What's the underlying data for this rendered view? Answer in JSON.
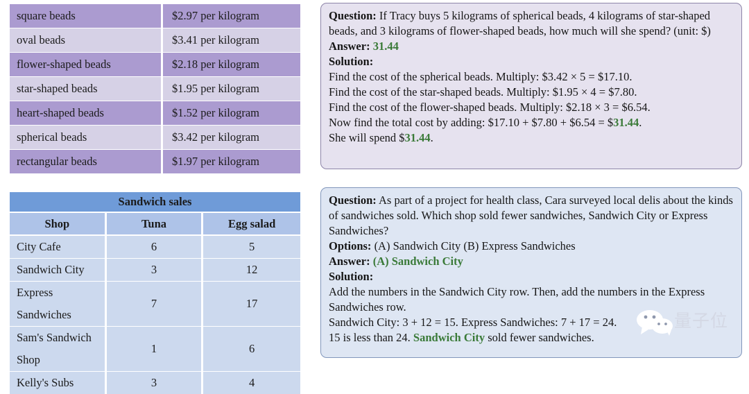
{
  "bead_table": {
    "name": "bead-price-table",
    "columns": [
      "item",
      "price"
    ],
    "rows": [
      {
        "item": "square beads",
        "price": "$2.97 per kilogram"
      },
      {
        "item": "oval beads",
        "price": "$3.41 per kilogram"
      },
      {
        "item": "flower-shaped beads",
        "price": "$2.18 per kilogram"
      },
      {
        "item": "star-shaped beads",
        "price": "$1.95 per kilogram"
      },
      {
        "item": "heart-shaped beads",
        "price": "$1.52 per kilogram"
      },
      {
        "item": "spherical beads",
        "price": "$3.42 per kilogram"
      },
      {
        "item": "rectangular beads",
        "price": "$1.97 per kilogram"
      }
    ],
    "colors": {
      "odd_row": "#ab9bd0",
      "even_row": "#d6d1e6"
    }
  },
  "sandwich_table": {
    "title": "Sandwich sales",
    "headers": [
      "Shop",
      "Tuna",
      "Egg salad"
    ],
    "rows": [
      {
        "shop": "City Cafe",
        "tuna": "6",
        "egg_salad": "5"
      },
      {
        "shop": "Sandwich City",
        "tuna": "3",
        "egg_salad": "12"
      },
      {
        "shop": "Express Sandwiches",
        "tuna": "7",
        "egg_salad": "17"
      },
      {
        "shop": "Sam's Sandwich Shop",
        "tuna": "1",
        "egg_salad": "6"
      },
      {
        "shop": "Kelly's Subs",
        "tuna": "3",
        "egg_salad": "4"
      }
    ],
    "colors": {
      "title_bar": "#6f9bd8",
      "header_row": "#aec3e8",
      "data_row": "#ccd9ee"
    }
  },
  "panel_beads": {
    "question_label": "Question:",
    "question_text": " If Tracy buys 5 kilograms of spherical beads, 4 kilograms of star-shaped beads, and 3 kilograms of flower-shaped beads, how much will she spend? (unit: $)",
    "answer_label": "Answer:",
    "answer_value": "31.44",
    "solution_label": "Solution:",
    "solution_line1": "Find the cost of the spherical beads. Multiply: $3.42 × 5 = $17.10.",
    "solution_line2": "Find the cost of the star-shaped beads. Multiply: $1.95 × 4 = $7.80.",
    "solution_line3": "Find the cost of the flower-shaped beads. Multiply: $2.18 × 3 = $6.54.",
    "solution_line4_pre": "Now find the total cost by adding: $17.10 + $7.80 + $6.54 = $",
    "solution_line4_highlight": "31.44",
    "solution_line4_post": ".",
    "solution_line5_pre": "She will spend $",
    "solution_line5_highlight": "31.44",
    "solution_line5_post": ".",
    "answer_color": "#3a7a38"
  },
  "panel_sandwich": {
    "question_label": "Question:",
    "question_text": " As part of a project for health class, Cara surveyed local delis about the kinds of sandwiches sold. Which shop sold fewer sandwiches, Sandwich City or Express Sandwiches?",
    "options_label": "Options:",
    "options_text": " (A) Sandwich City (B) Express Sandwiches",
    "answer_label": "Answer:",
    "answer_value": "(A) Sandwich City",
    "solution_label": "Solution:",
    "solution_line1": "Add the numbers in the Sandwich City row. Then, add the numbers in the Express Sandwiches row.",
    "solution_line2": "Sandwich City: 3 + 12 = 15. Express Sandwiches: 7 + 17 = 24.",
    "solution_line3_pre": "15 is less than 24. ",
    "solution_line3_highlight": "Sandwich City",
    "solution_line3_post": " sold fewer sandwiches.",
    "answer_color": "#3a7a38"
  },
  "watermark": {
    "text": "量子位",
    "logo_icon": "wechat-bubbles-icon"
  }
}
